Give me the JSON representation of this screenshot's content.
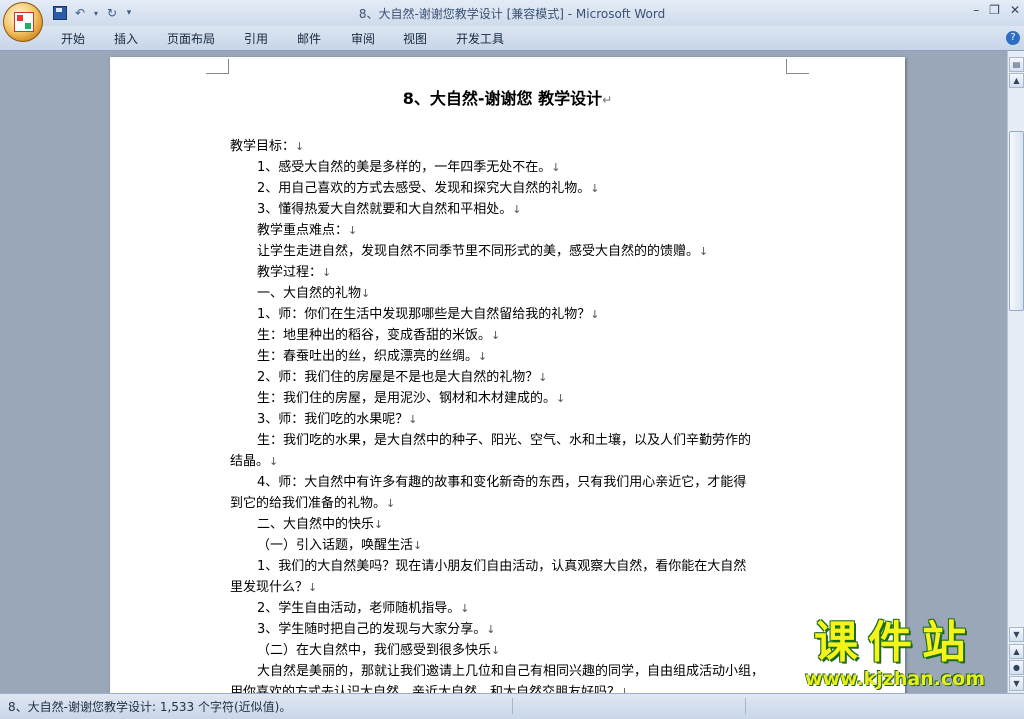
{
  "window": {
    "title": "8、大自然-谢谢您教学设计 [兼容模式] - Microsoft Word"
  },
  "ribbon": {
    "tabs": [
      "开始",
      "插入",
      "页面布局",
      "引用",
      "邮件",
      "审阅",
      "视图",
      "开发工具"
    ]
  },
  "document": {
    "title": "8、大自然-谢谢您  教学设计",
    "lines": [
      "教学目标：",
      "1、感受大自然的美是多样的，一年四季无处不在。",
      "2、用自己喜欢的方式去感受、发现和探究大自然的礼物。",
      "3、懂得热爱大自然就要和大自然和平相处。",
      "教学重点难点：",
      "让学生走进自然，发现自然不同季节里不同形式的美，感受大自然的的馈赠。",
      "教学过程：",
      "一、大自然的礼物",
      "1、师：你们在生活中发现那哪些是大自然留给我的礼物？",
      "生：地里种出的稻谷，变成香甜的米饭。",
      "生：春蚕吐出的丝，织成漂亮的丝绸。",
      "2、师：我们住的房屋是不是也是大自然的礼物？",
      "生：我们住的房屋，是用泥沙、钢材和木材建成的。",
      "3、师：我们吃的水果呢？",
      "生：我们吃的水果，是大自然中的种子、阳光、空气、水和土壤，以及人们辛勤劳作的",
      "结晶。",
      "4、师：大自然中有许多有趣的故事和变化新奇的东西，只有我们用心亲近它，才能得",
      "到它的给我们准备的礼物。",
      "二、大自然中的快乐",
      "（一）引入话题，唤醒生活",
      "1、我们的大自然美吗？现在请小朋友们自由活动，认真观察大自然，看你能在大自然",
      "里发现什么？",
      "2、学生自由活动，老师随机指导。",
      "3、学生随时把自己的发现与大家分享。",
      "（二）在大自然中，我们感受到很多快乐",
      "大自然是美丽的，那就让我们邀请上几位和自己有相同兴趣的同学，自由组成活动小组，",
      "用你喜欢的方式去认识大自然、亲近大自然，和大自然交朋友好吗？"
    ]
  },
  "status": {
    "text": "8、大自然-谢谢您教学设计: 1,533 个字符(近似值)。"
  },
  "watermark": {
    "main": "课件站",
    "url": "www.kjzhan.com"
  }
}
